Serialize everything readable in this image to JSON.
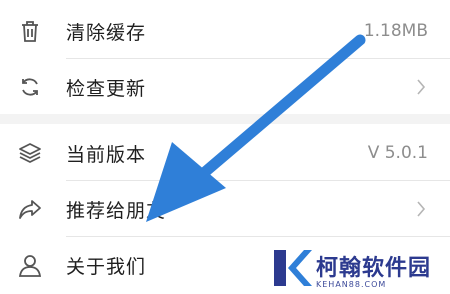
{
  "items": [
    {
      "label": "清除缓存",
      "value": "1.18MB",
      "icon": "trash-icon"
    },
    {
      "label": "检查更新",
      "icon": "refresh-icon"
    },
    {
      "label": "当前版本",
      "value": "V 5.0.1",
      "icon": "layers-icon"
    },
    {
      "label": "推荐给朋友",
      "icon": "share-icon"
    },
    {
      "label": "关于我们",
      "icon": "user-icon"
    }
  ],
  "watermark": {
    "name": "柯翰软件园",
    "url": "KEHAN88.COM"
  },
  "colors": {
    "arrow": "#2f7fd8",
    "text": "#1f1f1f",
    "secondary": "#8d8d8d",
    "brand": "#2c3a8f"
  }
}
